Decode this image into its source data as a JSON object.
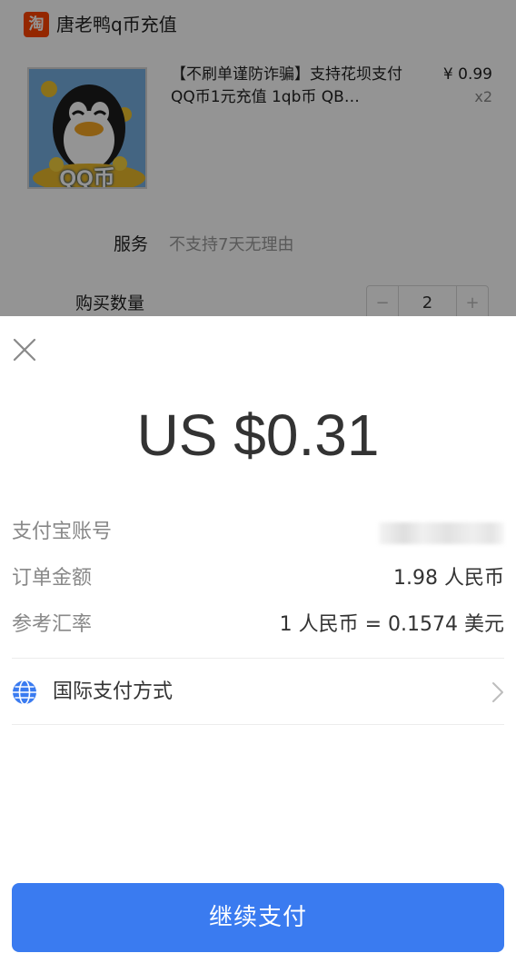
{
  "order": {
    "shop_icon": "淘",
    "shop_name": "唐老鸭q币充值",
    "product": {
      "image_caption": "QQ币",
      "title": "【不刷单谨防诈骗】支持花坝支付 QQ币1元充值 1qb币 QB…",
      "price": "¥ 0.99",
      "quantity": "x2"
    },
    "service_label": "服务",
    "service_value": "不支持7天无理由",
    "quantity_label": "购买数量",
    "stepper": {
      "minus": "−",
      "value": "2",
      "plus": "+"
    }
  },
  "payment": {
    "amount": "US $0.31",
    "rows": [
      {
        "label": "支付宝账号",
        "value": ""
      },
      {
        "label": "订单金额",
        "value": "1.98 人民币"
      },
      {
        "label": "参考汇率",
        "value": "1 人民币 = 0.1574 美元"
      }
    ],
    "method_label": "国际支付方式",
    "continue_label": "继续支付"
  },
  "icons": {
    "close": "close-icon",
    "globe": "globe-icon",
    "chevron": "chevron-right-icon",
    "shop": "taobao-icon"
  },
  "colors": {
    "primary_button": "#3a7bf0",
    "shop_logo": "#ff4400",
    "globe": "#3a7bf0"
  }
}
